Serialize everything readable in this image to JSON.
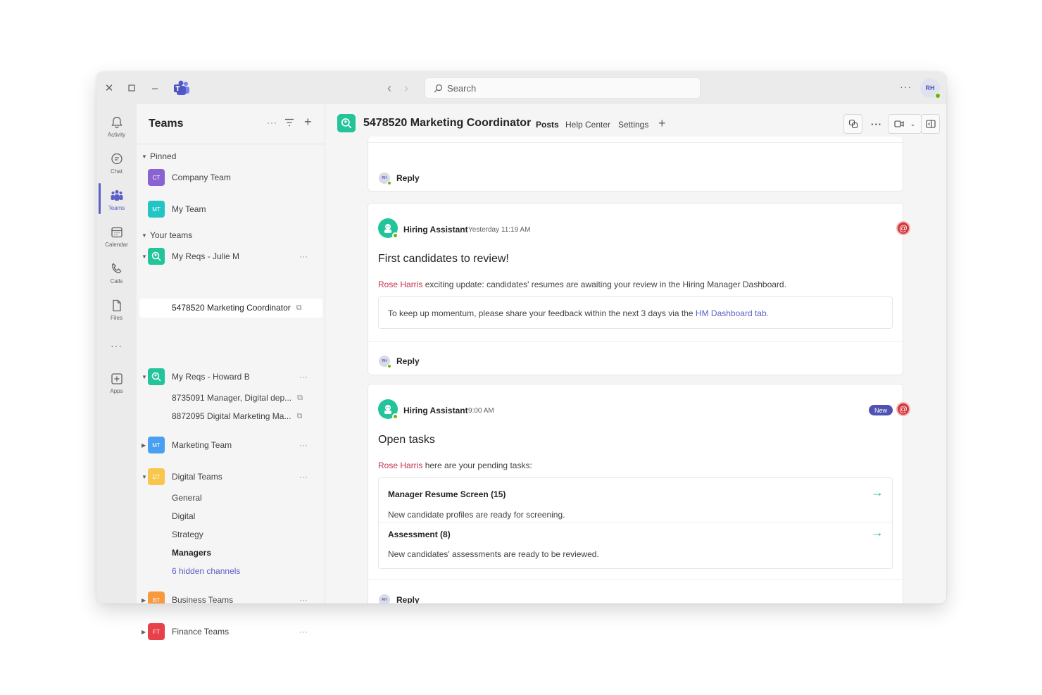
{
  "titlebar": {
    "search_placeholder": "Search",
    "user_initials": "RH"
  },
  "rail": [
    {
      "label": "Activity",
      "icon": "bell-icon"
    },
    {
      "label": "Chat",
      "icon": "chat-icon"
    },
    {
      "label": "Teams",
      "icon": "teams-icon",
      "active": true
    },
    {
      "label": "Calendar",
      "icon": "calendar-icon"
    },
    {
      "label": "Calls",
      "icon": "phone-icon"
    },
    {
      "label": "Files",
      "icon": "file-icon"
    },
    {
      "label": "Apps",
      "icon": "apps-icon"
    }
  ],
  "teams_pane": {
    "title": "Teams",
    "pinned_label": "Pinned",
    "pinned": [
      {
        "initials": "CT",
        "name": "Company Team",
        "color": "#8a63d2"
      },
      {
        "initials": "MT",
        "name": "My Team",
        "color": "#23c4c4"
      }
    ],
    "your_teams_label": "Your teams",
    "teams": [
      {
        "name": "My Reqs - Julie M",
        "color": "#23c49a",
        "channels": [
          "5478520 Marketing Coordinator"
        ]
      },
      {
        "name": "My Reqs - Howard B",
        "color": "#23c49a",
        "channels": [
          "8735091 Manager, Digital dep...",
          "8872095 Digital Marketing Ma..."
        ]
      },
      {
        "initials": "MT",
        "name": "Marketing Team",
        "color": "#4aa0f0"
      },
      {
        "initials": "DT",
        "name": "Digital Teams",
        "color": "#f7c64a",
        "channels": [
          "General",
          "Digital",
          "Strategy",
          "Managers",
          "6 hidden channels"
        ]
      },
      {
        "initials": "BT",
        "name": "Business Teams",
        "color": "#f79a3e"
      },
      {
        "initials": "FT",
        "name": "Finance Teams",
        "color": "#e8414a"
      }
    ]
  },
  "channel": {
    "title": "5478520 Marketing Coordinator",
    "tabs": [
      "Posts",
      "Help Center",
      "Settings"
    ]
  },
  "posts": {
    "reply_label": "Reply",
    "post1": {
      "sender": "Hiring Assistant",
      "time": "Yesterday 11:19 AM",
      "title": "First candidates to review!",
      "mention": "Rose Harris",
      "text": " exciting update: candidates' resumes are awaiting your review in the Hiring Manager Dashboard.",
      "box_text": "To keep up momentum, please share your feedback within the next 3 days via the ",
      "box_link": "HM Dashboard tab."
    },
    "post2": {
      "sender": "Hiring Assistant",
      "time": "9:00 AM",
      "badge": "New",
      "title": "Open tasks",
      "mention": "Rose Harris",
      "text": " here are your pending tasks:",
      "tasks": [
        {
          "title": "Manager Resume Screen (15)",
          "desc": "New candidate profiles are ready for screening."
        },
        {
          "title": "Assessment (8)",
          "desc": "New candidates' assessments are ready to be reviewed."
        }
      ]
    }
  },
  "colors": {
    "accent": "#5b5fc7",
    "brand_green": "#23c49a",
    "mention_red": "#d13438"
  }
}
